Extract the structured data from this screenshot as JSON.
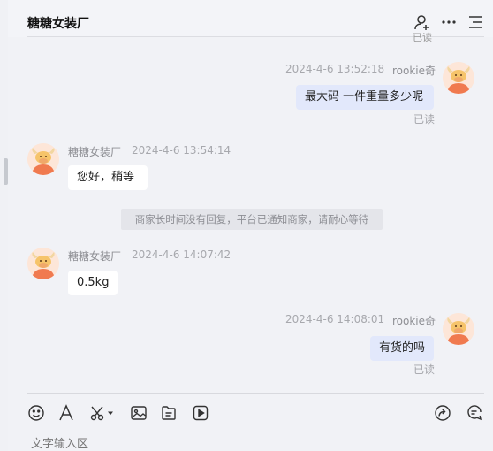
{
  "header": {
    "title": "糖糖女装厂"
  },
  "peek_text": "已读",
  "messages": [
    {
      "sender": "rookie奇",
      "time": "2024-4-6 13:52:18",
      "text": "最大码 一件重量多少呢",
      "status": "已读"
    },
    {
      "sender": "糖糖女装厂",
      "time": "2024-4-6 13:54:14",
      "text": "您好，稍等"
    },
    {
      "sender": "糖糖女装厂",
      "time": "2024-4-6 14:07:42",
      "text": "0.5kg"
    },
    {
      "sender": "rookie奇",
      "time": "2024-4-6 14:08:01",
      "text": "有货的吗",
      "status": "已读"
    }
  ],
  "system_notice": "商家长时间没有回复，平台已通知商家，请耐心等待",
  "composer": {
    "placeholder": "文字输入区"
  },
  "icons": {
    "header": [
      "add-contact-icon",
      "more-icon",
      "menu-icon"
    ],
    "toolbar": [
      "emoji-icon",
      "font-icon",
      "screenshot-icon",
      "image-icon",
      "file-icon",
      "video-icon",
      "share-icon",
      "quick-reply-icon"
    ]
  },
  "colors": {
    "my_bubble": "#e2e8fb",
    "their_bubble": "#ffffff",
    "avatar_orange": "#f07a4f"
  }
}
